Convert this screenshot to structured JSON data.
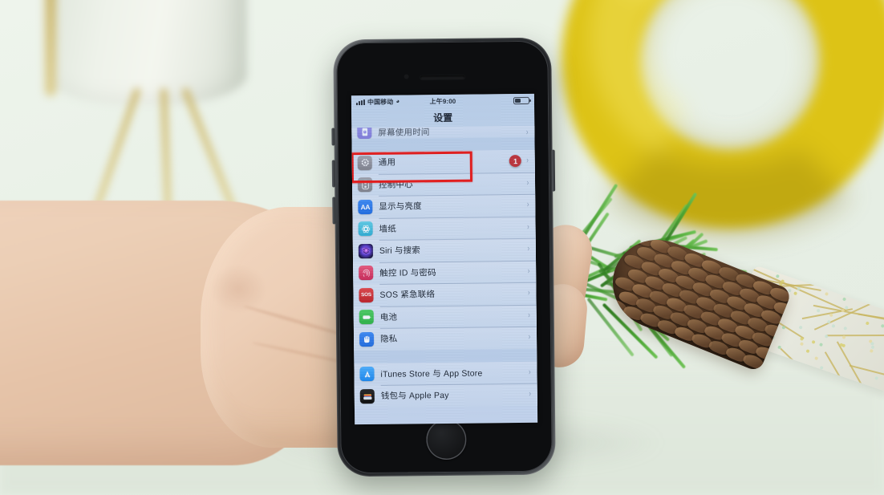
{
  "scene": {
    "description": "Hand holding a space-gray iPhone displaying the iOS Settings app in Chinese",
    "background_objects": [
      "white-planter-on-gold-tripod",
      "yellow-ring-ornament",
      "pine-branch",
      "pine-cone",
      "sparkle-mesh-ribbon"
    ],
    "colors": {
      "background": "#e9f1e7",
      "ring_yellow": "#ddc316",
      "phone_body": "#2a2d30",
      "skin": "#eccfb6",
      "pinecone_brown": "#553a25",
      "pine_green": "#49a534"
    }
  },
  "phone": {
    "device": "iPhone",
    "body_color": "space-gray"
  },
  "status_bar": {
    "carrier": "中国移动",
    "wifi_icon": "wifi-icon",
    "time": "上午9:00",
    "battery_percent": 40
  },
  "nav_bar": {
    "title": "设置"
  },
  "highlight": {
    "color": "#f31a1a",
    "target_row": "通用"
  },
  "settings_groups": [
    {
      "group_name": "screen-time-group",
      "rows": [
        {
          "label": "屏幕使用时间",
          "icon": "screentime-icon",
          "icon_class": "ic-screentime",
          "badge": null,
          "clipped": true
        }
      ]
    },
    {
      "group_name": "system-group",
      "rows": [
        {
          "label": "通用",
          "icon": "gear-icon",
          "icon_class": "ic-general",
          "badge": "1",
          "clipped": false
        },
        {
          "label": "控制中心",
          "icon": "control-center-icon",
          "icon_class": "ic-control",
          "badge": null,
          "clipped": false
        },
        {
          "label": "显示与亮度",
          "icon": "display-aa-icon",
          "icon_class": "ic-display",
          "badge": null,
          "clipped": false
        },
        {
          "label": "墙纸",
          "icon": "wallpaper-icon",
          "icon_class": "ic-wallpaper",
          "badge": null,
          "clipped": false
        },
        {
          "label": "Siri 与搜索",
          "icon": "siri-icon",
          "icon_class": "ic-siri",
          "badge": null,
          "clipped": false
        },
        {
          "label": "触控 ID 与密码",
          "icon": "touch-id-icon",
          "icon_class": "ic-touchid",
          "badge": null,
          "clipped": false
        },
        {
          "label": "SOS 紧急联络",
          "icon": "sos-icon",
          "icon_class": "ic-sos",
          "badge": null,
          "clipped": false
        },
        {
          "label": "电池",
          "icon": "battery-icon",
          "icon_class": "ic-battery",
          "badge": null,
          "clipped": false
        },
        {
          "label": "隐私",
          "icon": "privacy-hand-icon",
          "icon_class": "ic-privacy",
          "badge": null,
          "clipped": false
        }
      ]
    },
    {
      "group_name": "store-group",
      "rows": [
        {
          "label": "iTunes Store 与 App Store",
          "icon": "app-store-icon",
          "icon_class": "ic-itunes",
          "badge": null,
          "clipped": false
        },
        {
          "label": "钱包与 Apple Pay",
          "icon": "wallet-icon",
          "icon_class": "ic-wallet",
          "badge": null,
          "clipped": false
        }
      ]
    }
  ],
  "chevron_glyph": "›"
}
